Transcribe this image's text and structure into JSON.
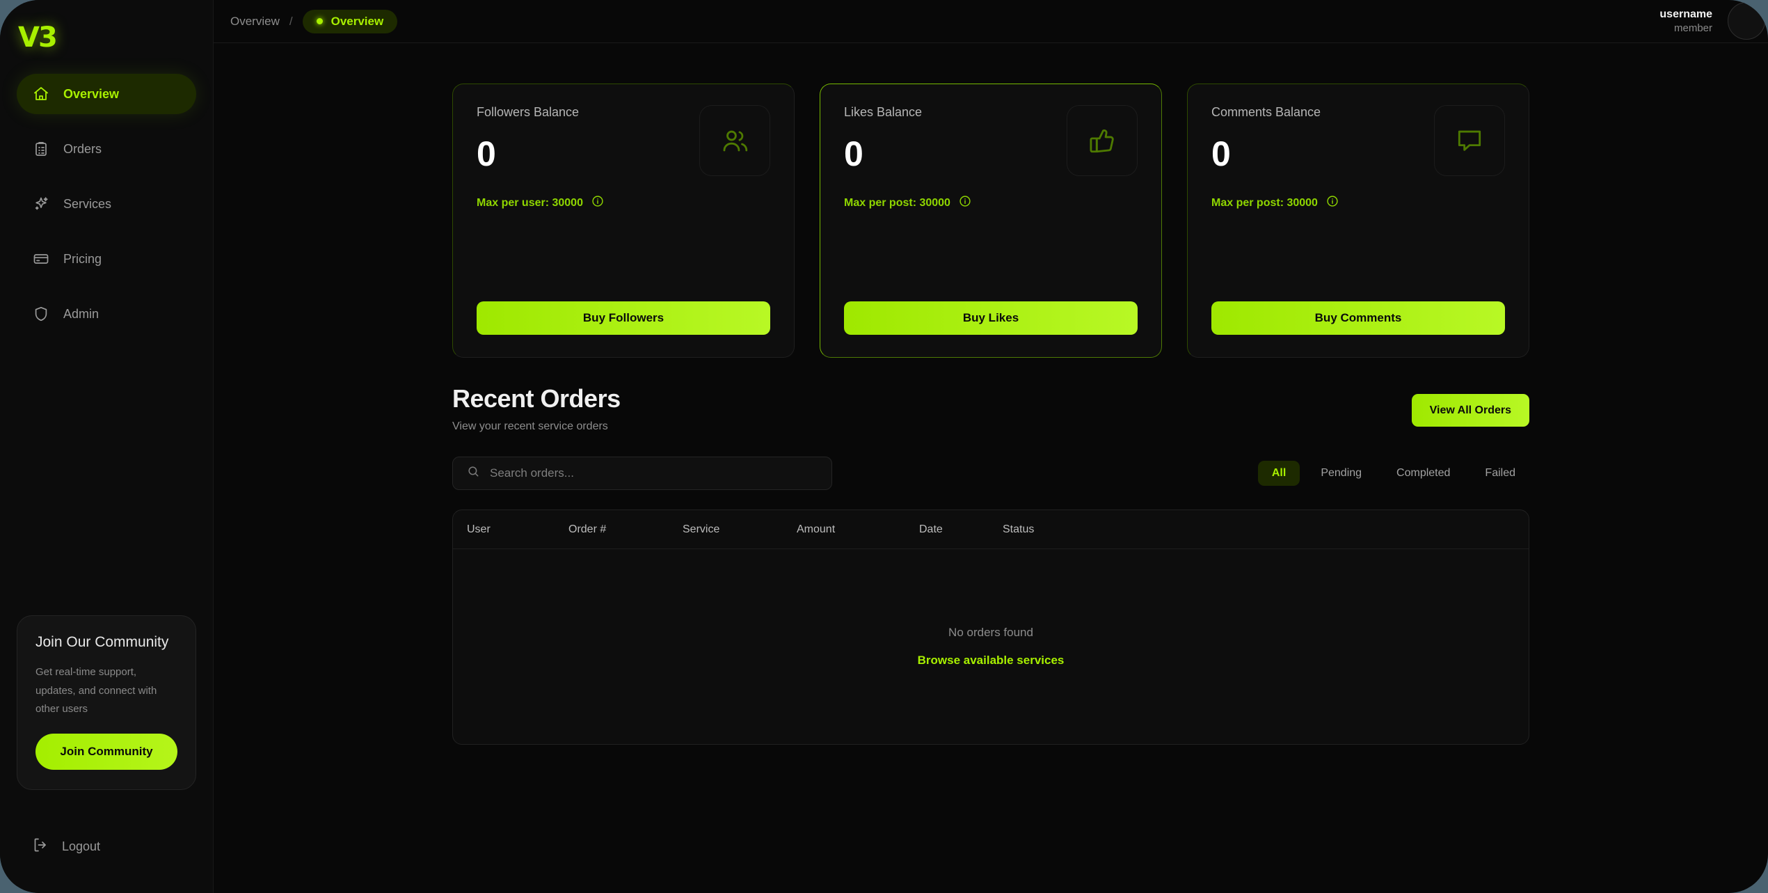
{
  "brand": {
    "logo": "V3"
  },
  "sidebar": {
    "items": [
      {
        "label": "Overview",
        "icon": "home-icon",
        "active": true
      },
      {
        "label": "Orders",
        "icon": "clipboard-icon",
        "active": false
      },
      {
        "label": "Services",
        "icon": "sparkles-icon",
        "active": false
      },
      {
        "label": "Pricing",
        "icon": "credit-card-icon",
        "active": false
      },
      {
        "label": "Admin",
        "icon": "shield-icon",
        "active": false
      }
    ],
    "community": {
      "title": "Join Our Community",
      "description": "Get real-time support, updates, and connect with other users",
      "button": "Join Community"
    },
    "logout": {
      "label": "Logout",
      "icon": "logout-icon"
    }
  },
  "topbar": {
    "breadcrumb_root": "Overview",
    "breadcrumb_separator": "/",
    "breadcrumb_current": "Overview",
    "user": {
      "name": "username",
      "role": "member"
    }
  },
  "cards": [
    {
      "label": "Followers Balance",
      "value": "0",
      "max_text": "Max per user: 30000",
      "icon": "users-icon",
      "button": "Buy Followers",
      "highlight": false
    },
    {
      "label": "Likes Balance",
      "value": "0",
      "max_text": "Max per post: 30000",
      "icon": "thumbs-up-icon",
      "button": "Buy Likes",
      "highlight": true
    },
    {
      "label": "Comments Balance",
      "value": "0",
      "max_text": "Max per post: 30000",
      "icon": "comment-icon",
      "button": "Buy Comments",
      "highlight": false
    }
  ],
  "orders": {
    "title": "Recent Orders",
    "subtitle": "View your recent service orders",
    "view_all_label": "View All Orders",
    "search_placeholder": "Search orders...",
    "search_value": "",
    "tabs": [
      {
        "label": "All",
        "active": true
      },
      {
        "label": "Pending",
        "active": false
      },
      {
        "label": "Completed",
        "active": false
      },
      {
        "label": "Failed",
        "active": false
      }
    ],
    "columns": [
      "User",
      "Order #",
      "Service",
      "Amount",
      "Date",
      "Status"
    ],
    "rows": [],
    "empty_message": "No orders found",
    "empty_link": "Browse available services"
  },
  "colors": {
    "accent": "#a8f000",
    "accent_button": "#9fe800",
    "page_bg": "#080808",
    "outer_bg": "#4a6270",
    "sidebar_bg": "#0c0c0c"
  }
}
